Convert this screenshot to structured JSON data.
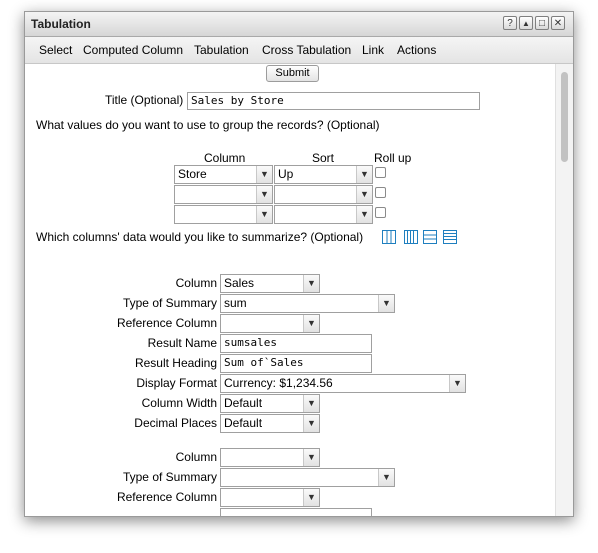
{
  "window": {
    "title": "Tabulation"
  },
  "titlebar_buttons": {
    "help": "?",
    "up": "▲",
    "max": "□",
    "close": "✕"
  },
  "menu": [
    "Select",
    "Computed Column",
    "Tabulation",
    "Cross Tabulation",
    "Link",
    "Actions"
  ],
  "submit_label": "Submit",
  "title_field": {
    "label": "Title (Optional)",
    "value": "Sales by Store"
  },
  "group_prompt": "What values do you want to use to group the records? (Optional)",
  "group_headers": {
    "column": "Column",
    "sort": "Sort",
    "rollup": "Roll up"
  },
  "group_rows": [
    {
      "column": "Store",
      "sort": "Up"
    },
    {
      "column": "",
      "sort": ""
    },
    {
      "column": "",
      "sort": ""
    }
  ],
  "summarize_prompt": "Which columns' data would you like to summarize? (Optional)",
  "layout_icons": [
    "layout-columns-icon",
    "layout-dense-columns-icon",
    "layout-rows-icon",
    "layout-dense-rows-icon"
  ],
  "summary1": {
    "labels": {
      "column": "Column",
      "type": "Type of Summary",
      "reference": "Reference Column",
      "result_name": "Result Name",
      "result_heading": "Result Heading",
      "display_format": "Display Format",
      "column_width": "Column Width",
      "decimal_places": "Decimal Places"
    },
    "column": "Sales",
    "type": "sum",
    "reference": "",
    "result_name": "sumsales",
    "result_heading": "Sum of`Sales",
    "display_format": "Currency: $1,234.56",
    "column_width": "Default",
    "decimal_places": "Default"
  },
  "summary2": {
    "labels": {
      "column": "Column",
      "type": "Type of Summary",
      "reference": "Reference Column"
    },
    "column": "",
    "type": "",
    "reference": ""
  },
  "arrow": "▼"
}
